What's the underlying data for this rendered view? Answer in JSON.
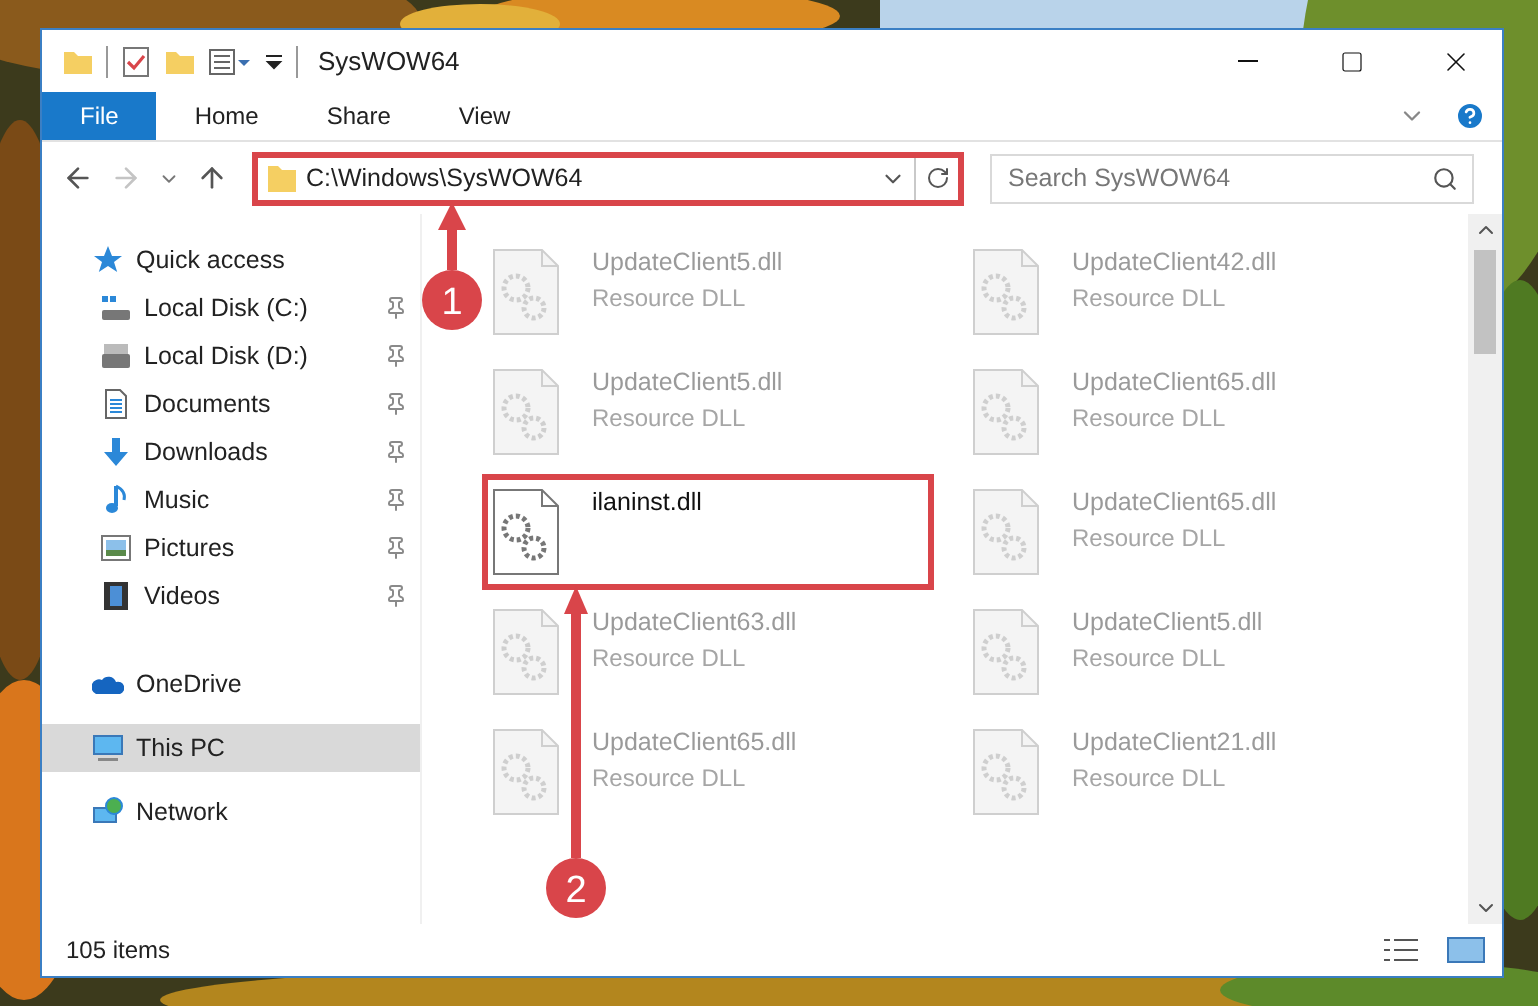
{
  "window": {
    "title": "SysWOW64"
  },
  "ribbon_tabs": [
    {
      "label": "File",
      "kind": "file"
    },
    {
      "label": "Home",
      "kind": "tab"
    },
    {
      "label": "Share",
      "kind": "tab"
    },
    {
      "label": "View",
      "kind": "tab"
    }
  ],
  "address": {
    "path": "C:\\Windows\\SysWOW64",
    "highlighted": true
  },
  "search": {
    "placeholder": "Search SysWOW64"
  },
  "sidebar": {
    "items": [
      {
        "label": "Quick access",
        "kind": "star",
        "selected": false,
        "children": [
          {
            "label": "Local Disk (C:)",
            "kind": "drive-c",
            "pinned": true,
            "selected": false
          },
          {
            "label": "Local Disk (D:)",
            "kind": "drive",
            "pinned": true,
            "selected": false
          },
          {
            "label": "Documents",
            "kind": "documents",
            "pinned": true,
            "selected": false
          },
          {
            "label": "Downloads",
            "kind": "downloads",
            "pinned": true,
            "selected": false
          },
          {
            "label": "Music",
            "kind": "music",
            "pinned": true,
            "selected": false
          },
          {
            "label": "Pictures",
            "kind": "pictures",
            "pinned": true,
            "selected": false
          },
          {
            "label": "Videos",
            "kind": "videos",
            "pinned": true,
            "selected": false
          }
        ]
      },
      {
        "label": "OneDrive",
        "kind": "cloud",
        "selected": false
      },
      {
        "label": "This PC",
        "kind": "pc",
        "selected": true
      },
      {
        "label": "Network",
        "kind": "network",
        "selected": false
      }
    ]
  },
  "files": [
    {
      "name": "UpdateClient5.dll",
      "type": "Resource DLL",
      "faded": true,
      "highlighted": false
    },
    {
      "name": "UpdateClient42.dll",
      "type": "Resource DLL",
      "faded": true,
      "highlighted": false
    },
    {
      "name": "UpdateClient5.dll",
      "type": "Resource DLL",
      "faded": true,
      "highlighted": false
    },
    {
      "name": "UpdateClient65.dll",
      "type": "Resource DLL",
      "faded": true,
      "highlighted": false
    },
    {
      "name": "ilaninst.dll",
      "faded": false,
      "highlighted": true
    },
    {
      "name": "UpdateClient65.dll",
      "type": "Resource DLL",
      "faded": true,
      "highlighted": false
    },
    {
      "name": "UpdateClient63.dll",
      "type": "Resource DLL",
      "faded": true,
      "highlighted": false
    },
    {
      "name": "UpdateClient5.dll",
      "type": "Resource DLL",
      "faded": true,
      "highlighted": false
    },
    {
      "name": "UpdateClient65.dll",
      "type": "Resource DLL",
      "faded": true,
      "highlighted": false
    },
    {
      "name": "UpdateClient21.dll",
      "type": "Resource DLL",
      "faded": true,
      "highlighted": false
    }
  ],
  "status_bar": {
    "count": "105 items"
  },
  "callouts": [
    {
      "number": "1"
    },
    {
      "number": "2"
    }
  ]
}
